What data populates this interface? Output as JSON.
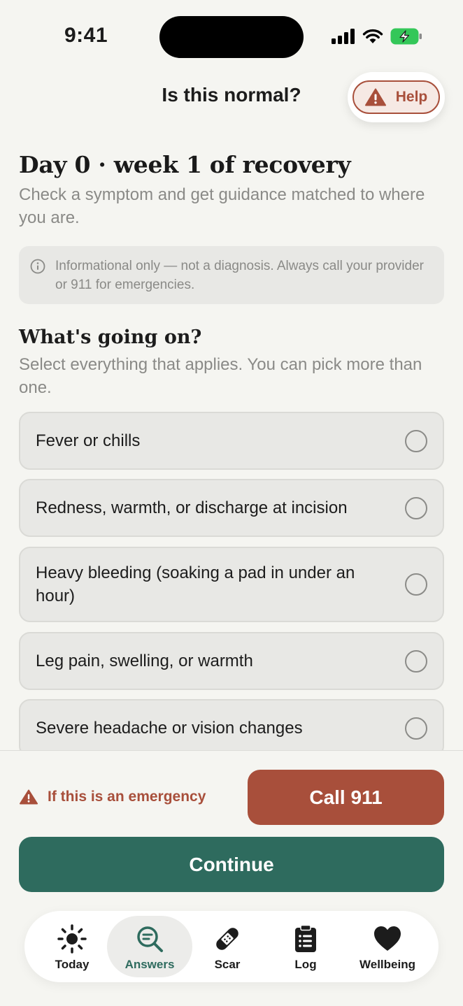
{
  "status": {
    "time": "9:41"
  },
  "header": {
    "title": "Is this normal?",
    "help_label": "Help"
  },
  "intro": {
    "title": "Day 0 · week 1 of recovery",
    "subtitle": "Check a symptom and get guidance matched to where you are."
  },
  "info": {
    "text": "Informational only — not a diagnosis. Always call your provider or 911 for emergencies."
  },
  "symptoms": {
    "title": "What's going on?",
    "subtitle": "Select everything that applies. You can pick more than one.",
    "items": [
      {
        "label": "Fever or chills",
        "selected": false
      },
      {
        "label": "Redness, warmth, or discharge at incision",
        "selected": false
      },
      {
        "label": "Heavy bleeding (soaking a pad in under an hour)",
        "selected": false
      },
      {
        "label": "Leg pain, swelling, or warmth",
        "selected": false
      },
      {
        "label": "Severe headache or vision changes",
        "selected": false
      }
    ]
  },
  "emergency": {
    "label": "If this is an emergency",
    "call_label": "Call 911"
  },
  "actions": {
    "continue_label": "Continue"
  },
  "tabs": [
    {
      "label": "Today",
      "icon": "sun-icon",
      "active": false
    },
    {
      "label": "Answers",
      "icon": "search-answer-icon",
      "active": true
    },
    {
      "label": "Scar",
      "icon": "bandage-icon",
      "active": false
    },
    {
      "label": "Log",
      "icon": "clipboard-icon",
      "active": false
    },
    {
      "label": "Wellbeing",
      "icon": "heart-icon",
      "active": false
    }
  ],
  "colors": {
    "accent_green": "#2e6b5e",
    "alert_red": "#a84f3b",
    "background": "#f5f5f1"
  }
}
